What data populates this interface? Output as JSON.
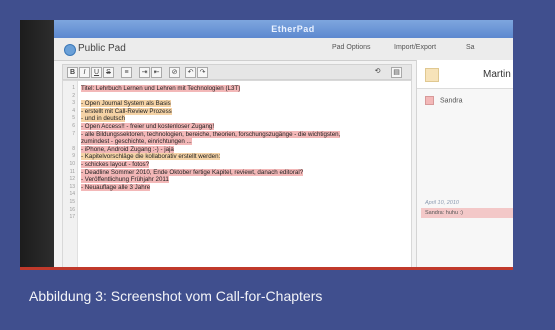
{
  "app": {
    "title": "EtherPad",
    "pad_name": "Public Pad",
    "top_buttons": [
      "Pad Options",
      "Import/Export",
      "Sa"
    ]
  },
  "toolbar": {
    "bold": "B",
    "italic": "I",
    "underline": "U",
    "strike": "S",
    "undo": "↶",
    "redo": "↷"
  },
  "editor": {
    "lines": [
      {
        "n": "1",
        "text": "Titel: Lehrbuch Lernen und Lehren mit Technologien  (L3T)",
        "style": "hl"
      },
      {
        "n": "2",
        "text": "",
        "style": ""
      },
      {
        "n": "3",
        "text": "- Open Journal System als Basis",
        "style": "hl2"
      },
      {
        "n": "4",
        "text": "- erstellt mit Call-Review Prozess",
        "style": "hl2"
      },
      {
        "n": "5",
        "text": "- und in deutsch",
        "style": "hl2"
      },
      {
        "n": "6",
        "text": "- Open Access!! - freier und kostenloser Zugang!",
        "style": "hl"
      },
      {
        "n": "7",
        "text": "- alle Bildungssektoren, technologien, bereiche, theorien, forschungszugänge - die wichtigsten,",
        "style": "hl"
      },
      {
        "n": "",
        "text": "zumindest - geschichte, einrichtungen ...",
        "style": "hl"
      },
      {
        "n": "8",
        "text": "- iPhone, Android Zugang :-) - jaja",
        "style": "hl"
      },
      {
        "n": "9",
        "text": "- Kapitelvorschläge die kollaborativ erstellt werden:",
        "style": "hl2"
      },
      {
        "n": "10",
        "text": "- schickes layout - fotos?",
        "style": "hl"
      },
      {
        "n": "11",
        "text": "- Deadline Sommer 2010, Ende Oktober fertige Kapitel, reviewt, danach editoral?",
        "style": "hl"
      },
      {
        "n": "12",
        "text": "- Veröffentlichung Frühjahr 2011",
        "style": "hl"
      },
      {
        "n": "13",
        "text": "- Neuauflage alle 3 Jahre",
        "style": "hl"
      },
      {
        "n": "14",
        "text": "",
        "style": ""
      },
      {
        "n": "15",
        "text": "",
        "style": ""
      },
      {
        "n": "16",
        "text": "",
        "style": ""
      },
      {
        "n": "17",
        "text": "",
        "style": ""
      }
    ]
  },
  "users": {
    "current": "Martin",
    "other": "Sandra"
  },
  "chat": {
    "date": "April 10, 2010",
    "message": "Sandra: huhu :)"
  },
  "caption": "Abbildung 3: Screenshot vom Call-for-Chapters"
}
